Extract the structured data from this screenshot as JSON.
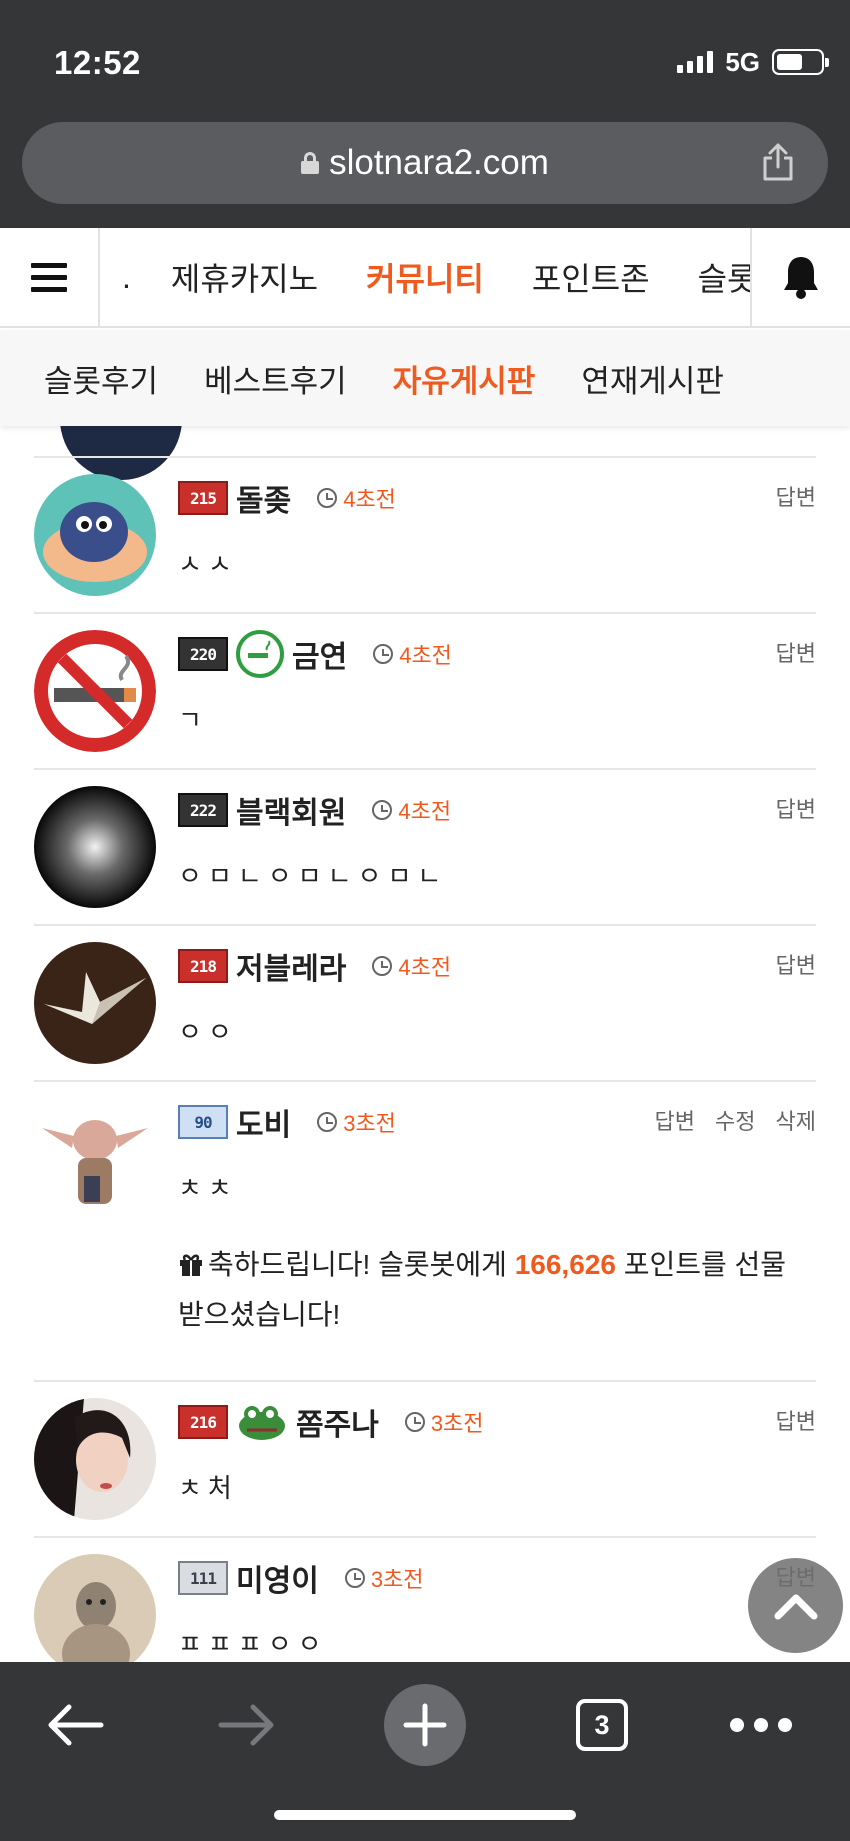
{
  "status": {
    "time": "12:52",
    "network": "5G"
  },
  "browser": {
    "url": "slotnara2.com",
    "tab_count": "3"
  },
  "nav": {
    "items": [
      {
        "label": "."
      },
      {
        "label": "제휴카지노"
      },
      {
        "label": "커뮤니티",
        "active": true
      },
      {
        "label": "포인트존"
      },
      {
        "label": "슬롯"
      }
    ]
  },
  "subnav": {
    "items": [
      {
        "label": "슬롯후기"
      },
      {
        "label": "베스트후기"
      },
      {
        "label": "자유게시판",
        "active": true
      },
      {
        "label": "연재게시판"
      }
    ]
  },
  "comments": [
    {
      "level": "215",
      "nick": "돌좆",
      "time": "4초전",
      "body": "ㅅㅅ",
      "actions": [
        "답변"
      ]
    },
    {
      "level": "220",
      "nick": "금연",
      "time": "4초전",
      "body": "ㄱ",
      "actions": [
        "답변"
      ]
    },
    {
      "level": "222",
      "nick": "블랙회원",
      "time": "4초전",
      "body": "ㅇㅁㄴㅇㅁㄴㅇㅁㄴ",
      "actions": [
        "답변"
      ]
    },
    {
      "level": "218",
      "nick": "저블레라",
      "time": "4초전",
      "body": "ㅇㅇ",
      "actions": [
        "답변"
      ]
    },
    {
      "level": "90",
      "nick": "도비",
      "time": "3초전",
      "body": "ㅊㅊ",
      "actions": [
        "답변",
        "수정",
        "삭제"
      ],
      "notice": {
        "pre": "축하드립니다! 슬롯봇에게 ",
        "points": "166,626",
        "post": " 포인트를 선물받으셨습니다!"
      }
    },
    {
      "level": "216",
      "nick": "쫌주나",
      "time": "3초전",
      "body": "ㅊ처",
      "actions": [
        "답변"
      ]
    },
    {
      "level": "111",
      "nick": "미영이",
      "time": "3초전",
      "body": "ㅍㅍㅍㅇㅇ",
      "actions": [
        "답변"
      ]
    }
  ],
  "colors": {
    "accent": "#ef5a1f",
    "chrome": "#353638"
  }
}
